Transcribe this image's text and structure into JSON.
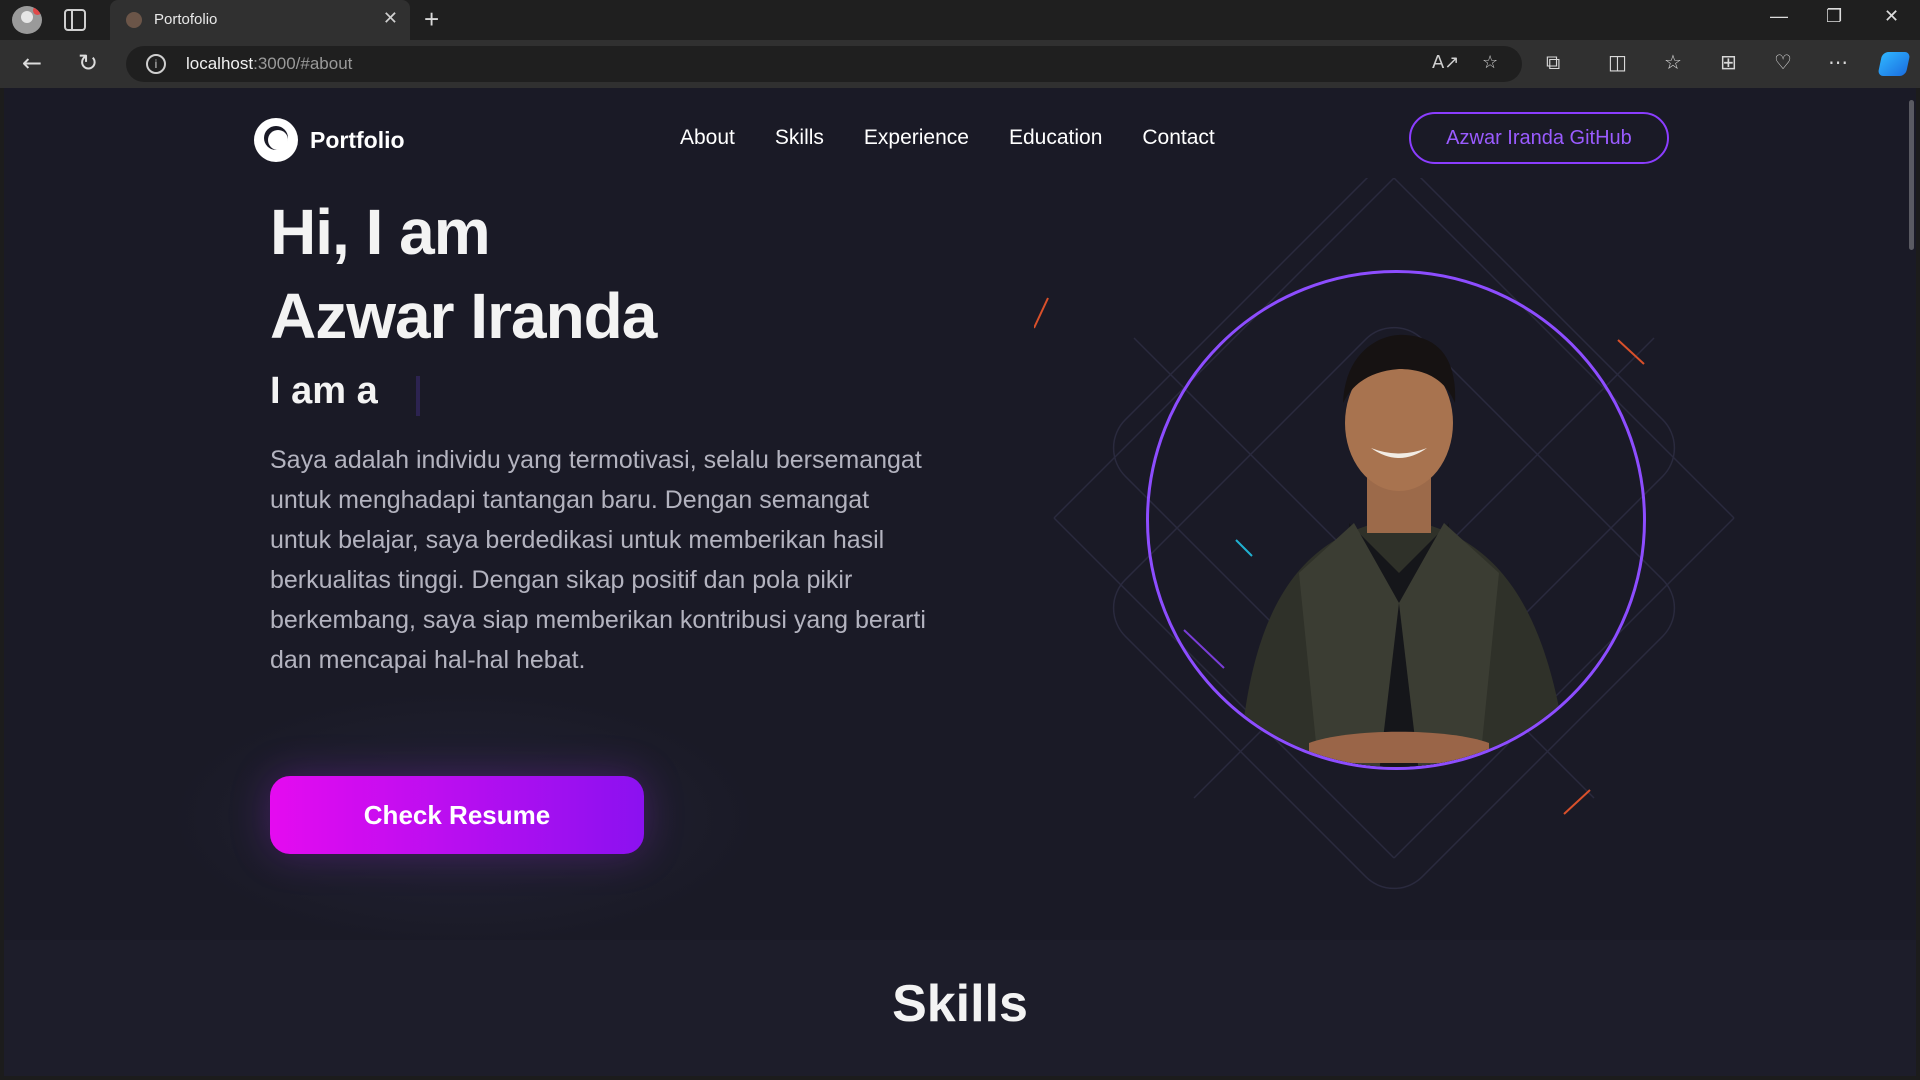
{
  "browser": {
    "tab_title": "Portofolio",
    "url_host": "localhost",
    "url_path": ":3000/#about",
    "icons": [
      "profile-icon",
      "tab-actions-icon",
      "close-icon",
      "new-tab-icon",
      "back-icon",
      "refresh-icon",
      "info-icon",
      "read-aloud-icon",
      "favorite-icon",
      "extensions-icon",
      "split-screen-icon",
      "favorites-icon",
      "collections-icon",
      "health-icon",
      "more-icon",
      "copilot-icon",
      "minimize-icon",
      "maximize-icon",
      "close-window-icon"
    ]
  },
  "nav": {
    "logo_text": "Portfolio",
    "links": [
      "About",
      "Skills",
      "Experience",
      "Education",
      "Contact"
    ],
    "github_button": "Azwar Iranda GitHub"
  },
  "hero": {
    "greeting_line1": "Hi, I am",
    "greeting_line2": "Azwar Iranda",
    "typing_prefix": "I am a",
    "description": "Saya adalah individu yang termotivasi, selalu bersemangat untuk menghadapi tantangan baru. Dengan semangat untuk belajar, saya berdedikasi untuk memberikan hasil berkualitas tinggi. Dengan sikap positif dan pola pikir berkembang, saya siap memberikan kontribusi yang berarti dan mencapai hal-hal hebat.",
    "resume_button": "Check Resume"
  },
  "sections": {
    "skills_title": "Skills"
  },
  "colors": {
    "page_bg": "#1a1a26",
    "accent_purple": "#8b3dff",
    "button_gradient_start": "#e50bf0",
    "button_gradient_end": "#8b11f0"
  }
}
